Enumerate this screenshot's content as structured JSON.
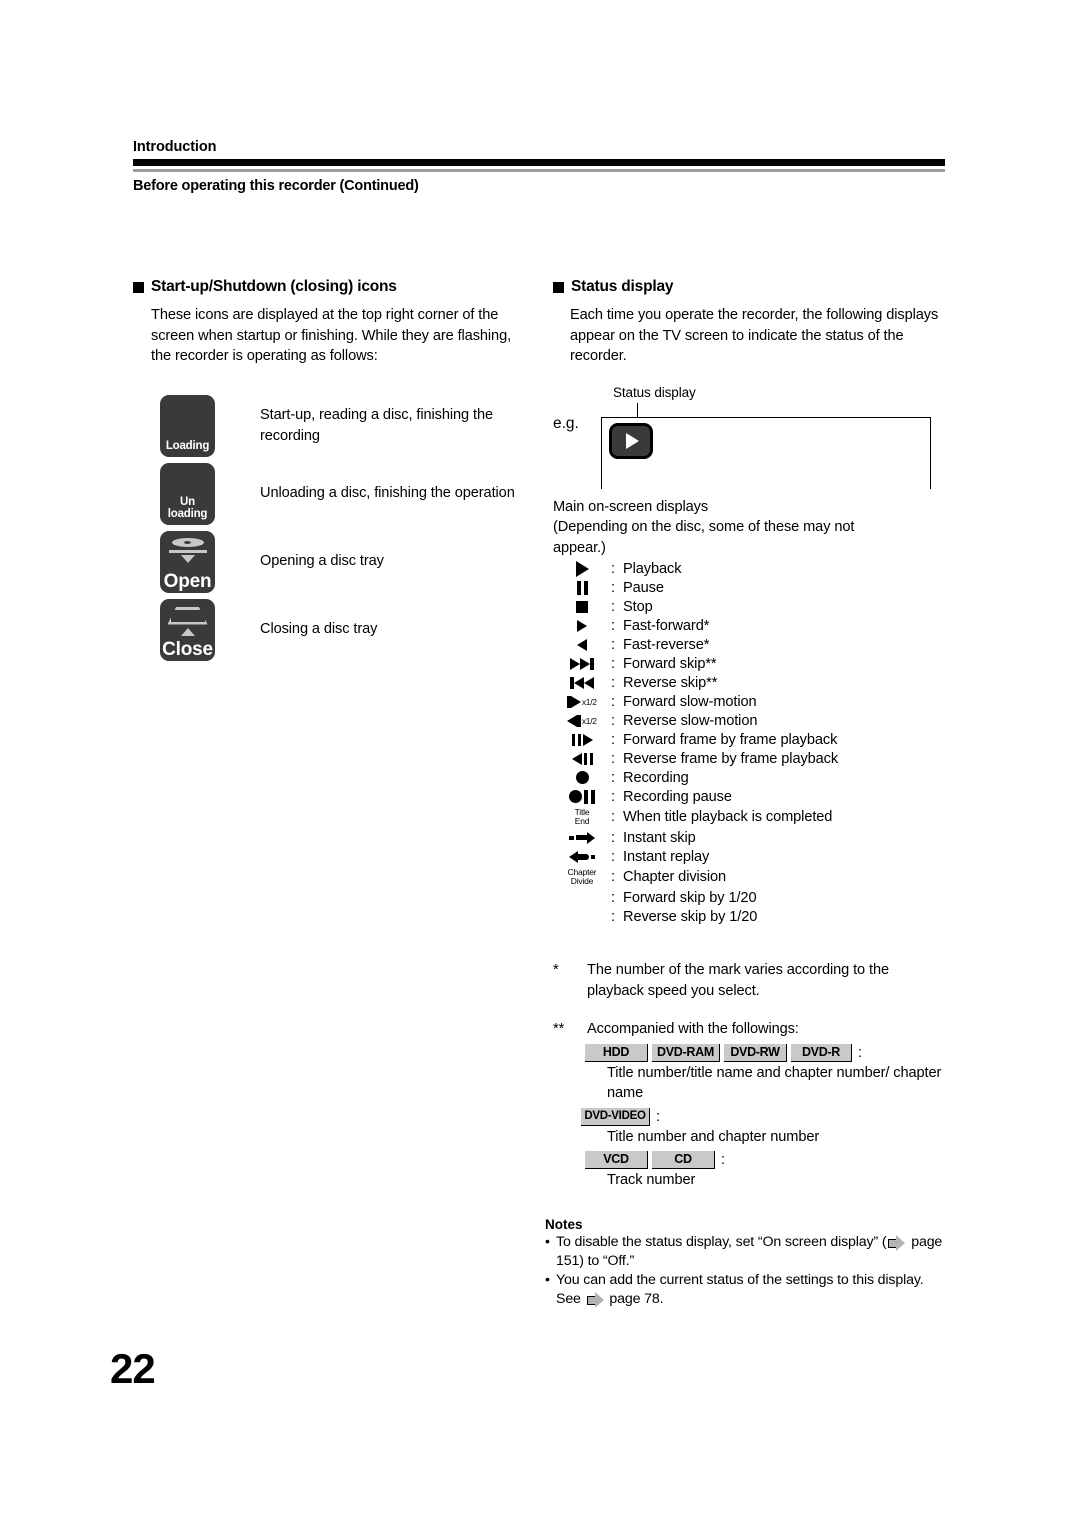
{
  "header": {
    "section": "Introduction",
    "title": "Before operating this recorder (Continued)"
  },
  "page_number": "22",
  "left_column": {
    "heading": "Start-up/Shutdown (closing) icons",
    "intro": "These icons are displayed at the top right corner of the screen when startup or finishing. While they are flashing, the recorder is operating as follows:",
    "icon_rows": [
      {
        "icon_name": "loading-tile",
        "tile_label": "Loading",
        "description": "Start-up, reading a disc, finishing the recording"
      },
      {
        "icon_name": "unloading-tile",
        "tile_label_line1": "Un",
        "tile_label_line2": "loading",
        "description": "Unloading a disc, finishing the operation"
      },
      {
        "icon_name": "open-tray-tile",
        "tile_label": "Open",
        "description": "Opening a disc tray"
      },
      {
        "icon_name": "close-tray-tile",
        "tile_label": "Close",
        "description": "Closing a disc tray"
      }
    ]
  },
  "right_column": {
    "heading": "Status display",
    "intro": "Each time you operate the recorder, the following displays appear on the TV screen to indicate the status of the recorder.",
    "example": {
      "caption": "Status display",
      "eg_label": "e.g.",
      "tile_icon": "play-icon"
    },
    "osd_intro_line1": "Main on-screen displays",
    "osd_intro_line2": "(Depending on the disc, some of these may not",
    "osd_intro_line3": "appear.)",
    "osd_items": [
      {
        "icon": "play-icon",
        "colon": ":",
        "label": "Playback"
      },
      {
        "icon": "pause-icon",
        "colon": ":",
        "label": "Pause"
      },
      {
        "icon": "stop-icon",
        "colon": ":",
        "label": "Stop"
      },
      {
        "icon": "fast-forward-icon",
        "colon": ":",
        "label": "Fast-forward*"
      },
      {
        "icon": "fast-reverse-icon",
        "colon": ":",
        "label": "Fast-reverse*"
      },
      {
        "icon": "forward-skip-icon",
        "colon": ":",
        "label": "Forward skip**"
      },
      {
        "icon": "reverse-skip-icon",
        "colon": ":",
        "label": "Reverse skip**"
      },
      {
        "icon": "forward-slow-motion-icon",
        "colon": ":",
        "label": "Forward slow-motion",
        "sub": "x1/2"
      },
      {
        "icon": "reverse-slow-motion-icon",
        "colon": ":",
        "label": "Reverse slow-motion",
        "sub": "x1/2"
      },
      {
        "icon": "forward-frame-step-icon",
        "colon": ":",
        "label": "Forward frame by frame playback"
      },
      {
        "icon": "reverse-frame-step-icon",
        "colon": ":",
        "label": "Reverse frame by frame playback"
      },
      {
        "icon": "record-icon",
        "colon": ":",
        "label": "Recording"
      },
      {
        "icon": "record-pause-icon",
        "colon": ":",
        "label": "Recording pause"
      },
      {
        "icon": "title-end-icon",
        "colon": ":",
        "label": "When title playback is completed",
        "word1": "Title",
        "word2": "End"
      },
      {
        "icon": "instant-skip-icon",
        "colon": ":",
        "label": "Instant skip"
      },
      {
        "icon": "instant-replay-icon",
        "colon": ":",
        "label": "Instant replay"
      },
      {
        "icon": "chapter-divide-icon",
        "colon": ":",
        "label": "Chapter division",
        "word1": "Chapter",
        "word2": "Divide"
      },
      {
        "icon": "none",
        "colon": ":",
        "label": "Forward skip by 1/20"
      },
      {
        "icon": "none",
        "colon": ":",
        "label": "Reverse skip by 1/20"
      }
    ],
    "footnotes": {
      "single_mark": "*",
      "single_text": "The number of the mark varies according to the playback speed you select.",
      "double_mark": "**",
      "double_text": "Accompanied with the followings:",
      "group1_badges": [
        "HDD",
        "DVD-RAM",
        "DVD-RW",
        "DVD-R"
      ],
      "group1_colon": ":",
      "group1_desc": "Title number/title name and chapter number/ chapter name",
      "group2_badges": [
        "DVD-VIDEO"
      ],
      "group2_colon": ":",
      "group2_desc": "Title number and chapter number",
      "group3_badges": [
        "VCD",
        "CD"
      ],
      "group3_colon": ":",
      "group3_desc": "Track number"
    },
    "notes": {
      "title": "Notes",
      "items": [
        {
          "bullet": "•",
          "part1": "To disable the status display, set “On screen display” (",
          "arrow": "arrow-right-icon",
          "part2": " page 151) to “Off.”"
        },
        {
          "bullet": "•",
          "part1": "You can add the current status of the settings to this display. See ",
          "arrow": "arrow-right-icon",
          "part2": " page 78."
        }
      ]
    }
  }
}
